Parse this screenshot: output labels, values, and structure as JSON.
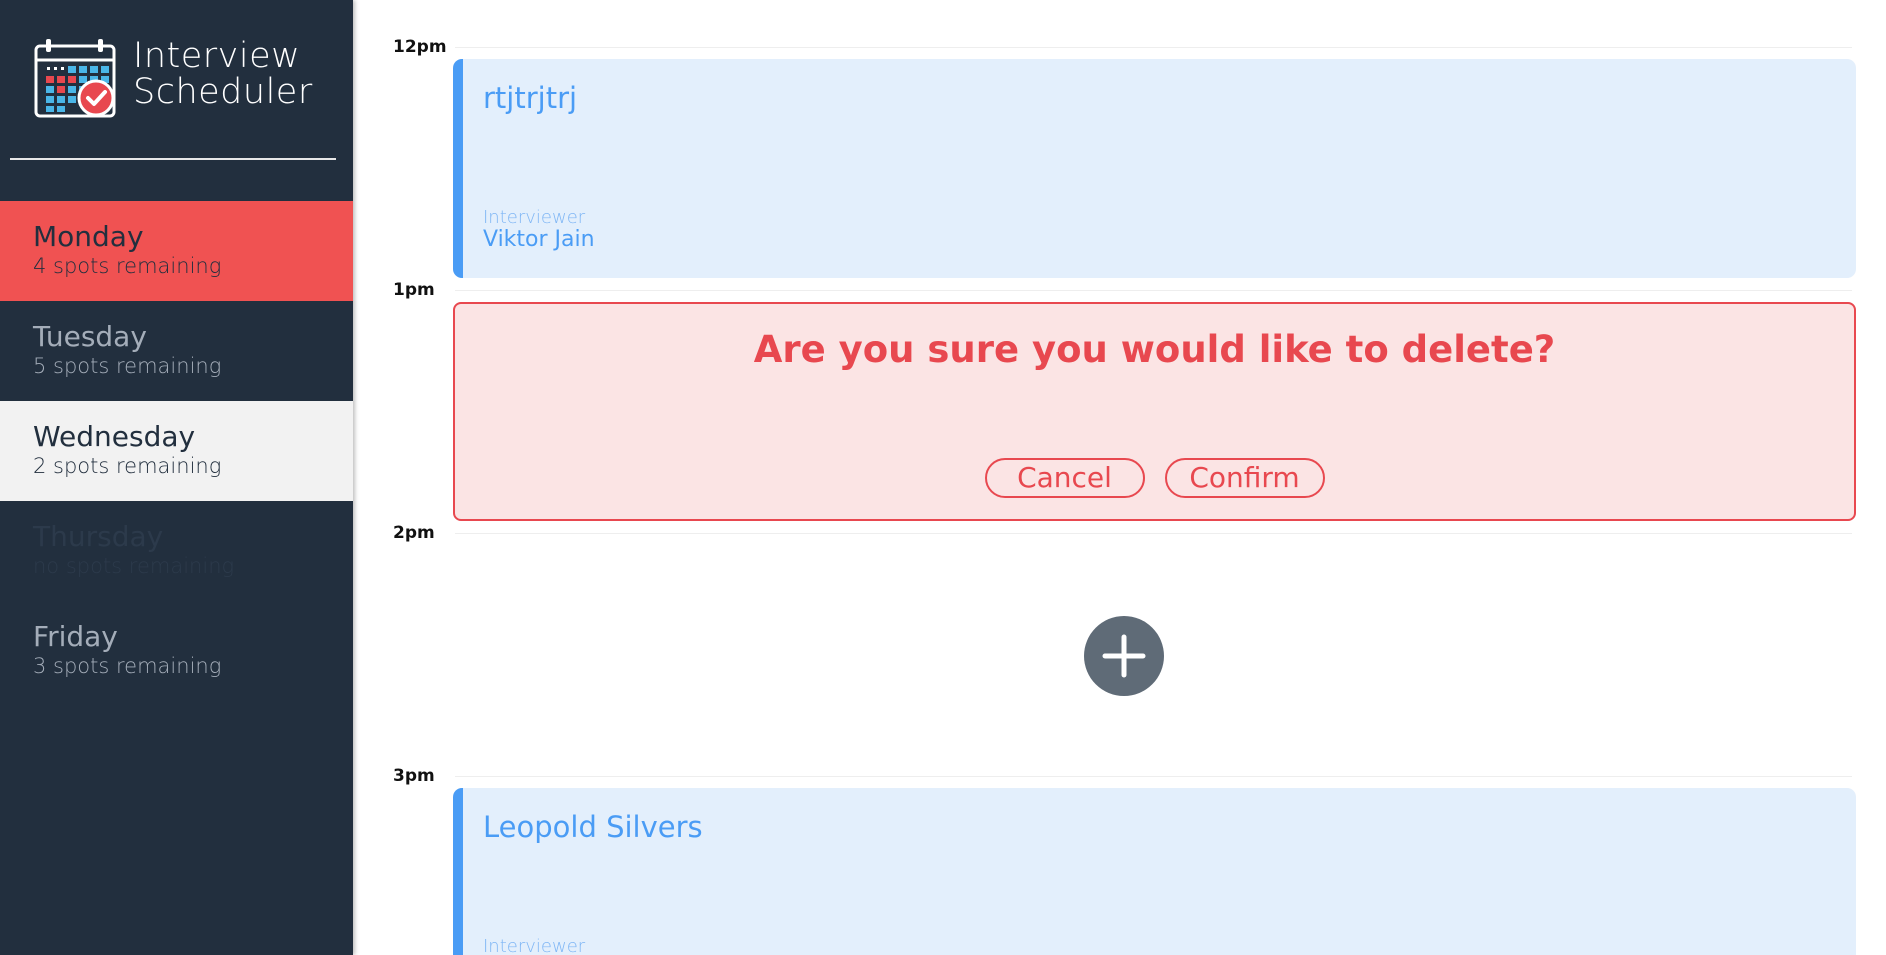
{
  "brand": {
    "line1": "Interview",
    "line2": "Scheduler"
  },
  "days": [
    {
      "name": "Monday",
      "spots": "4 spots remaining",
      "state": "selected"
    },
    {
      "name": "Tuesday",
      "spots": "5 spots remaining",
      "state": "normal"
    },
    {
      "name": "Wednesday",
      "spots": "2 spots remaining",
      "state": "hovered"
    },
    {
      "name": "Thursday",
      "spots": "no spots remaining",
      "state": "full"
    },
    {
      "name": "Friday",
      "spots": "3 spots remaining",
      "state": "normal"
    }
  ],
  "schedule": {
    "times": [
      "12pm",
      "1pm",
      "2pm",
      "3pm"
    ],
    "slot_12": {
      "student": "rtjtrjtrj",
      "interviewer_label": "Interviewer",
      "interviewer": "Viktor Jain"
    },
    "slot_1": {
      "message": "Are you sure you would like to delete?",
      "cancel_label": "Cancel",
      "confirm_label": "Confirm"
    },
    "slot_2": {
      "add_icon": "plus-icon"
    },
    "slot_3": {
      "student": "Leopold Silvers",
      "interviewer_label": "Interviewer"
    }
  },
  "colors": {
    "sidebar_bg": "#222f3e",
    "selected_day": "#f05252",
    "card_bg": "#e3effc",
    "card_accent": "#4a9cf5",
    "danger": "#e8484f",
    "danger_bg": "#fbe4e4",
    "add_button": "#5f6b77"
  }
}
